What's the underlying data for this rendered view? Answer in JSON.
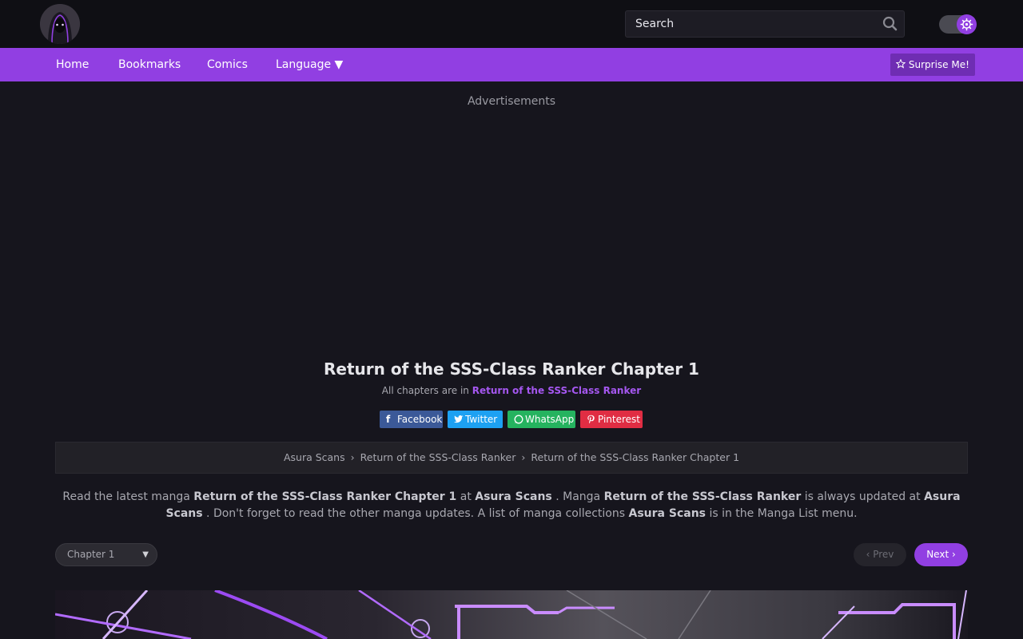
{
  "header": {
    "search_placeholder": "Search",
    "icons": {
      "logo": "hooded-figure-avatar",
      "search": "search-icon",
      "theme": "gear-icon"
    }
  },
  "nav": {
    "items": [
      {
        "label": "Home"
      },
      {
        "label": "Bookmarks"
      },
      {
        "label": "Comics"
      },
      {
        "label": "Language ▼"
      }
    ],
    "surprise_label": "Surprise Me!",
    "surprise_icon": "star-icon"
  },
  "ads_label": "Advertisements",
  "chapter": {
    "title": "Return of the SSS-Class Ranker Chapter 1",
    "all_prefix": "All chapters are in",
    "series_link": "Return of the SSS-Class Ranker"
  },
  "share": [
    {
      "label": "Facebook",
      "icon": "f",
      "color": "#3b5998"
    },
    {
      "label": "Twitter",
      "icon": "t",
      "color": "#1da1f2"
    },
    {
      "label": "WhatsApp",
      "icon": "w",
      "color": "#25b35f"
    },
    {
      "label": "Pinterest",
      "icon": "p",
      "color": "#e02d43"
    }
  ],
  "breadcrumb": [
    "Asura Scans",
    "Return of the SSS-Class Ranker",
    "Return of the SSS-Class Ranker Chapter 1"
  ],
  "desc": {
    "p1": "Read the latest manga",
    "b1": "Return of the SSS-Class Ranker Chapter 1",
    "p2": "at",
    "b2": "Asura Scans",
    "p3": ". Manga",
    "b3": "Return of the SSS-Class Ranker",
    "p4": "is always updated at",
    "b4": "Asura Scans",
    "p5": ". Don't forget to read the other manga updates. A list of manga collections",
    "b5": "Asura Scans",
    "p6": "is in the Manga List menu."
  },
  "pager": {
    "chapter_select": "Chapter 1",
    "prev": "‹ Prev",
    "next": "Next ›"
  },
  "colors": {
    "accent": "#913fe2",
    "bg": "#16151d",
    "header_bg": "#0f0f14"
  }
}
